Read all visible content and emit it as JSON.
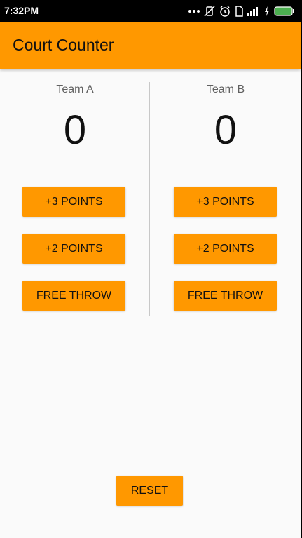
{
  "status_bar": {
    "time": "7:32PM",
    "icons": [
      "more-dots-icon",
      "mute-icon",
      "alarm-icon",
      "sim-icon",
      "signal-icon",
      "charging-icon",
      "battery-icon"
    ]
  },
  "app_bar": {
    "title": "Court Counter"
  },
  "team_a": {
    "name": "Team A",
    "score": "0",
    "buttons": {
      "three": "+3 POINTS",
      "two": "+2 POINTS",
      "free_throw": "FREE THROW"
    }
  },
  "team_b": {
    "name": "Team B",
    "score": "0",
    "buttons": {
      "three": "+3 POINTS",
      "two": "+2 POINTS",
      "free_throw": "FREE THROW"
    }
  },
  "reset_label": "RESET",
  "colors": {
    "accent": "#ff9800",
    "status_bar": "#000000",
    "background": "#fafafa",
    "battery": "#4caf50"
  }
}
